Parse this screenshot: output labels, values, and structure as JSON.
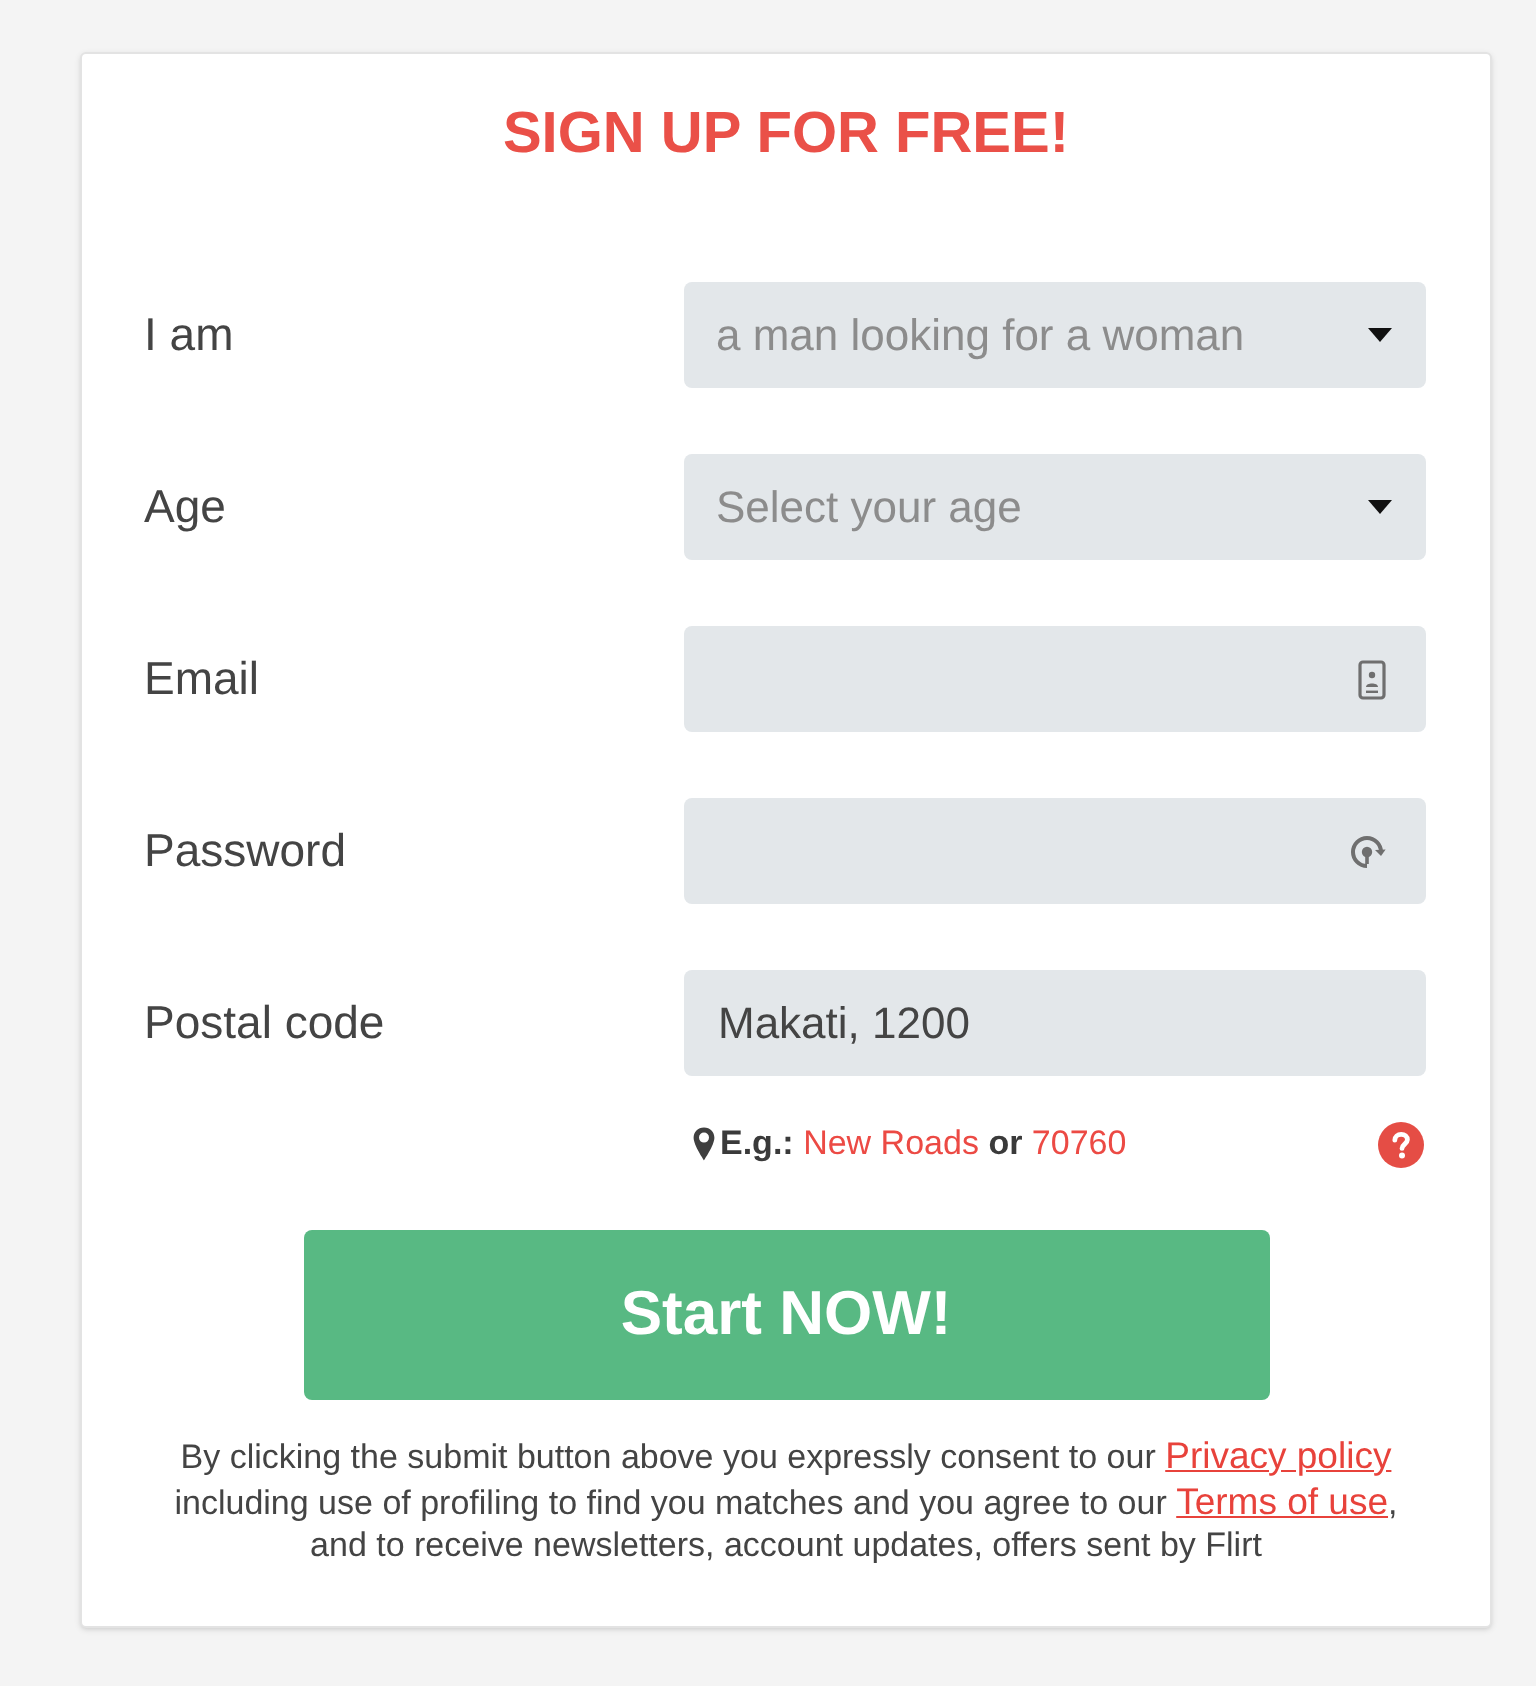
{
  "title": "SIGN UP FOR FREE!",
  "fields": [
    {
      "kind": "select",
      "label": "I am",
      "value": "a man looking for a woman"
    },
    {
      "kind": "select",
      "label": "Age",
      "placeholder": "Select your age"
    },
    {
      "kind": "email",
      "label": "Email"
    },
    {
      "kind": "password",
      "label": "Password"
    },
    {
      "kind": "text",
      "label": "Postal code",
      "value": "Makati, 1200"
    }
  ],
  "hint": {
    "parts": [
      {
        "kind": "bold",
        "text": "E.g.:"
      },
      {
        "kind": "link",
        "text": "New Roads"
      },
      {
        "kind": "bold",
        "text": "or"
      },
      {
        "kind": "link",
        "text": "70760"
      }
    ]
  },
  "submit_button": {
    "label": "Start NOW!"
  },
  "legal": {
    "parts": [
      {
        "kind": "text",
        "text": "By clicking the submit button above you expressly consent to our "
      },
      {
        "kind": "link",
        "text": "Privacy policy"
      },
      {
        "kind": "text",
        "text": " including use of profiling to find you matches and you agree to our "
      },
      {
        "kind": "link",
        "text": "Terms of use"
      },
      {
        "kind": "text",
        "text": ", and to receive newsletters, account updates, offers sent by Flirt"
      }
    ]
  }
}
